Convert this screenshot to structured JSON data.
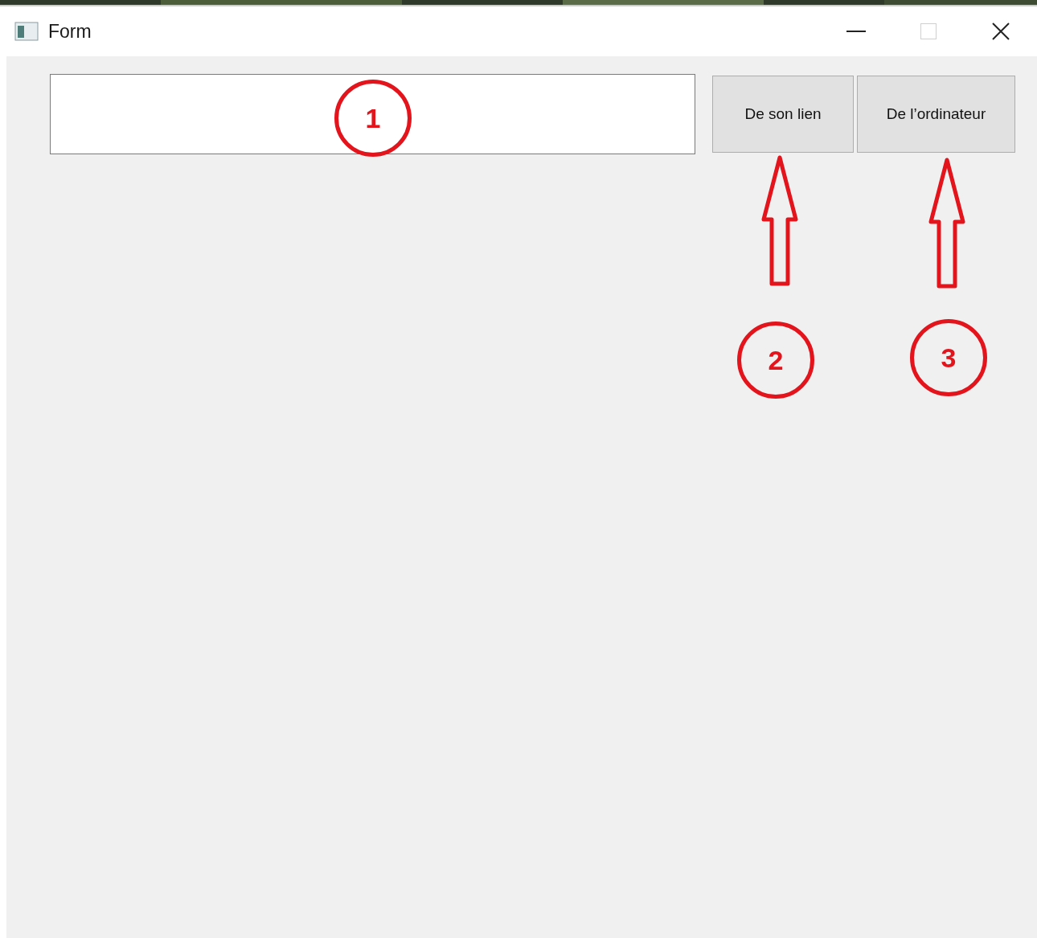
{
  "window": {
    "title": "Form",
    "maximize_disabled": true
  },
  "text_field": {
    "marker": "1"
  },
  "buttons": [
    {
      "label": "De son lien",
      "marker": "2"
    },
    {
      "label": "De l’ordinateur",
      "marker": "3"
    }
  ]
}
